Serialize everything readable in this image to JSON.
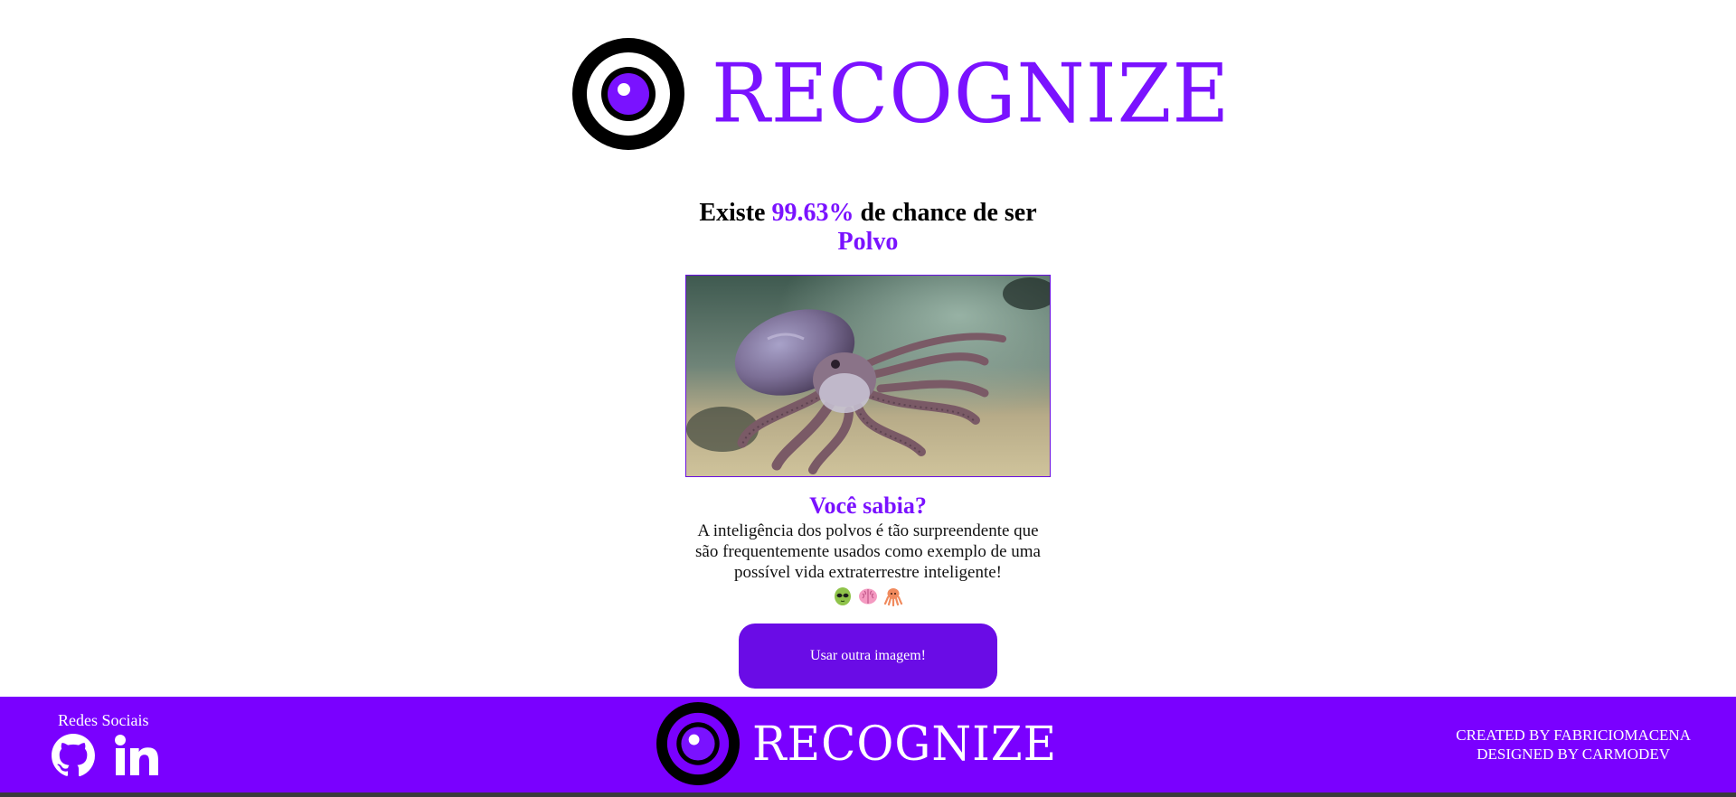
{
  "brand": {
    "name": "RECOGNIZE",
    "accent_color": "#7a12ff",
    "footer_color": "#7a00ff"
  },
  "result": {
    "prefix": "Existe",
    "percentage": "99.63%",
    "suffix": "de chance de ser",
    "label": "Polvo"
  },
  "photo": {
    "alt": "Polvo"
  },
  "fact": {
    "title": "Você sabia?",
    "text": "A inteligência dos polvos é tão surpreendente que são frequentemente usados como exemplo de uma possível vida extraterrestre inteligente!",
    "emojis": [
      "alien-icon",
      "brain-icon",
      "octopus-icon"
    ]
  },
  "button": {
    "label": "Usar outra imagem!"
  },
  "footer": {
    "social_title": "Redes Sociais",
    "social_icons": [
      "github-icon",
      "linkedin-icon"
    ],
    "credit_created": "CREATED BY FABRICIOMACENA",
    "credit_designed": "DESIGNED BY CARMODEV"
  }
}
